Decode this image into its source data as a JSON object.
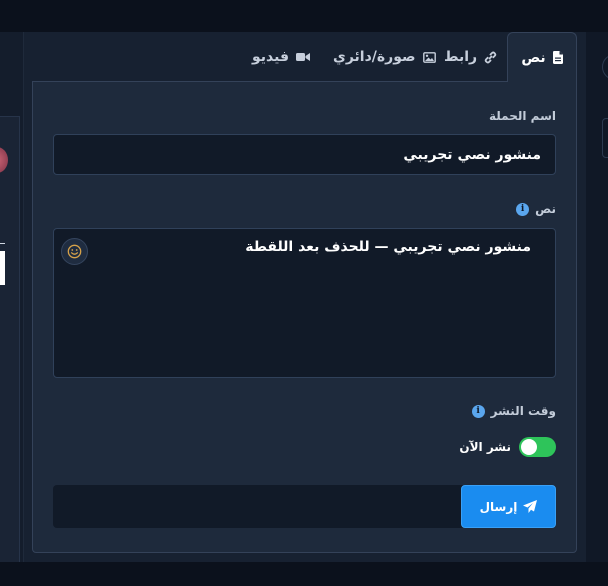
{
  "tabs": [
    {
      "label": "نص",
      "icon": "file-icon",
      "active": true
    },
    {
      "label": "رابط",
      "icon": "link-icon",
      "active": false
    },
    {
      "label": "صورة/دائري",
      "icon": "image-icon",
      "active": false
    },
    {
      "label": "فيديو",
      "icon": "video-icon",
      "active": false
    }
  ],
  "form": {
    "campaign_name_label": "اسم الحملة",
    "campaign_name_value": "منشور نصي تجريبي",
    "text_label": "نص",
    "text_value": "منشور نصي تجريبي — للحذف بعد اللقطة",
    "publish_time_label": "وقت النشر",
    "publish_now_label": "نشر الآن",
    "publish_now_enabled": true,
    "send_label": "إرسال"
  },
  "colors": {
    "accent": "#1a8cf0",
    "toggle_on": "#2ec45a",
    "info": "#5aa6ee"
  }
}
